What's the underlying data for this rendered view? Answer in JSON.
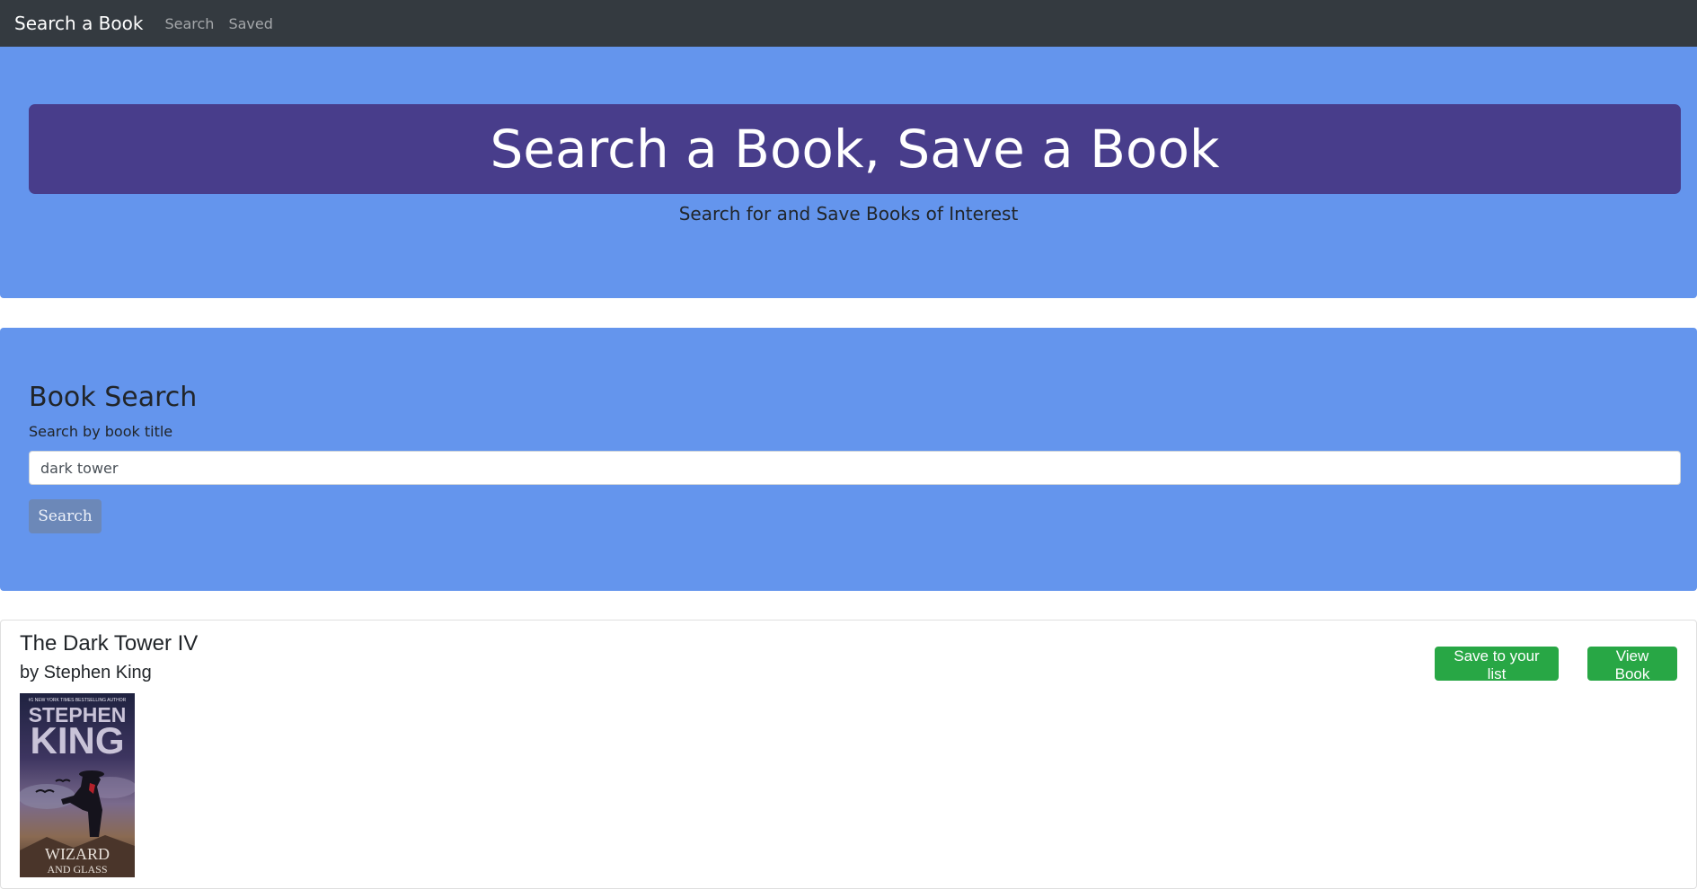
{
  "navbar": {
    "brand": "Search a Book",
    "links": [
      "Search",
      "Saved"
    ]
  },
  "hero": {
    "title": "Search a Book, Save a Book",
    "subtitle": "Search for and Save Books of Interest"
  },
  "search": {
    "heading": "Book Search",
    "label": "Search by book title",
    "input_value": "dark tower",
    "button_label": "Search"
  },
  "results": [
    {
      "title": "The Dark Tower IV",
      "author": "by Stephen King",
      "save_label": "Save to your list",
      "view_label": "View Book",
      "cover": {
        "top_line": "#1 NEW YORK TIMES BESTSELLING AUTHOR",
        "author_first": "STEPHEN",
        "author_last": "KING",
        "title_line1": "WIZARD",
        "title_line2": "AND GLASS"
      }
    }
  ],
  "colors": {
    "navbar_bg": "#343a40",
    "section_bg": "#6495ed",
    "hero_banner_bg": "#483d8b",
    "action_green": "#28a745"
  }
}
